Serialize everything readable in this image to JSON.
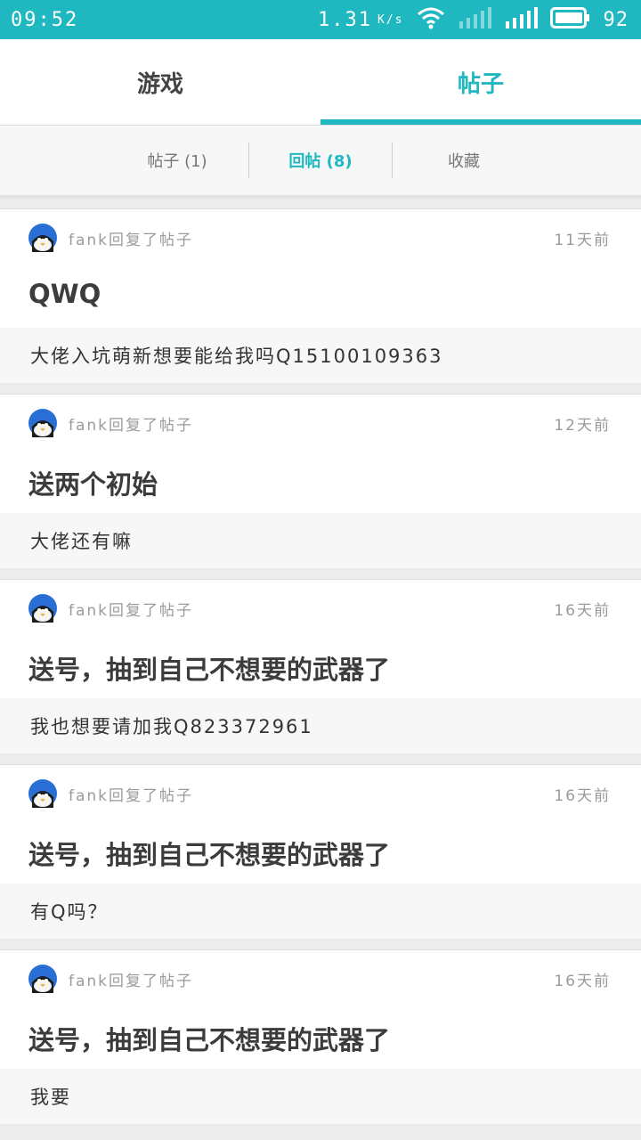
{
  "status_bar": {
    "time": "09:52",
    "speed": "1.31",
    "speed_unit": "K/s",
    "battery": "92"
  },
  "main_tabs": [
    {
      "label": "游戏",
      "active": false
    },
    {
      "label": "帖子",
      "active": true
    }
  ],
  "sub_tabs": [
    {
      "label": "帖子 (1)",
      "active": false
    },
    {
      "label": "回帖 (8)",
      "active": true
    },
    {
      "label": "收藏",
      "active": false
    }
  ],
  "posts": [
    {
      "meta": "fank回复了帖子",
      "time": "11天前",
      "title": "QWQ",
      "reply": "大佬入坑萌新想要能给我吗Q15100109363"
    },
    {
      "meta": "fank回复了帖子",
      "time": "12天前",
      "title": "送两个初始",
      "reply": "大佬还有嘛"
    },
    {
      "meta": "fank回复了帖子",
      "time": "16天前",
      "title": "送号，抽到自己不想要的武器了",
      "reply": "我也想要请加我Q823372961"
    },
    {
      "meta": "fank回复了帖子",
      "time": "16天前",
      "title": "送号，抽到自己不想要的武器了",
      "reply": "有Q吗？"
    },
    {
      "meta": "fank回复了帖子",
      "time": "16天前",
      "title": "送号，抽到自己不想要的武器了",
      "reply": "我要"
    }
  ],
  "colors": {
    "accent": "#1fb8c1",
    "background": "#ececec"
  }
}
